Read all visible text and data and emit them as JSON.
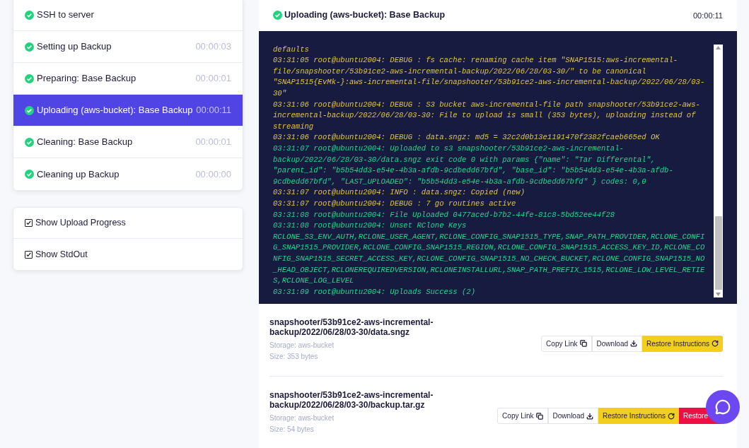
{
  "steps": [
    {
      "label": "SSH to server",
      "done": true,
      "selected": false
    },
    {
      "label": "Setting up Backup",
      "time": "00:00:03",
      "done": true,
      "selected": false
    },
    {
      "label": "Preparing: Base Backup",
      "time": "00:00:01",
      "done": true,
      "selected": false
    },
    {
      "label": "Uploading (aws-bucket): Base Backup",
      "time": "00:00:11",
      "done": true,
      "selected": true
    },
    {
      "label": "Cleaning: Base Backup",
      "time": "00:00:01",
      "done": true,
      "selected": false
    },
    {
      "label": "Cleaning up Backup",
      "time": "00:00:00",
      "done": true,
      "selected": false
    }
  ],
  "options": [
    {
      "label": "Show Upload Progress",
      "checked": true
    },
    {
      "label": "Show StdOut",
      "checked": true
    }
  ],
  "header": {
    "title": "Uploading (aws-bucket): Base Backup",
    "done": true,
    "time": "00:00:11"
  },
  "log": [
    {
      "text": "defaults",
      "color": "#e2c340"
    },
    {
      "text": "03:31:05 root@ubuntu2004: DEBUG : fs cache: renaming cache item \"SNAP1515:aws-incremental-file/snapshooter/53b91ce2-aws-incremental-backup/2022/06/28/03-30/\" to be canonical \"SNAP1515{EvMk-}:aws-incremental-file/snapshooter/53b91ce2-aws-incremental-backup/2022/06/28/03-30\"",
      "color": "#e2c340"
    },
    {
      "text": "03:31:06 root@ubuntu2004: DEBUG : S3 bucket aws-incremental-file path snapshooter/53b91ce2-aws-incremental-backup/2022/06/28/03-30: File to upload is small (353 bytes), uploading instead of streaming",
      "color": "#e2c340"
    },
    {
      "text": "03:31:06 root@ubuntu2004: DEBUG : data.sngz: md5 = 32c2d0b13e1191470f2382fcaeb665ed OK",
      "color": "#e2c340"
    },
    {
      "text": "03:31:07 root@ubuntu2004: Uploaded to s3 snapshooter/53b91ce2-aws-incremental-backup/2022/06/28/03-30/data.sngz exit code 0 with params {\"name\": \"Tar Differental\", \"parent_id\": \"b5b54dd3-e54e-4b3a-afdb-9cdbedd67bfd\", \"base_id\": \"b5b54dd3-e54e-4b3a-afdb-9cdbedd67bfd\", \"LAST_UPLOADED\": \"b5b54dd3-e54e-4b3a-afdb-9cdbedd67bfd\" } codes: 0,0",
      "color": "#1fd88a"
    },
    {
      "text": "03:31:07 root@ubuntu2004: INFO : data.sngz: Copied (new)",
      "color": "#e2c340"
    },
    {
      "text": "03:31:07 root@ubuntu2004: DEBUG : 7 go routines active",
      "color": "#e2c340"
    },
    {
      "text": "03:31:08 root@ubuntu2004: File Uploaded 0477aced-b7b2-44fe-81c8-5bd52ee44f28",
      "color": "#1fd88a"
    },
    {
      "text": "03:31:08 root@ubuntu2004: Unset RClone Keys RCLONE_S3_ENV_AUTH,RCLONE_USER_AGENT,RCLONE_CONFIG_SNAP1515_TYPE,SNAP_PATH_PROVIDER,RCLONE_CONFIG_SNAP1515_PROVIDER,RCLONE_CONFIG_SNAP1515_REGION,RCLONE_CONFIG_SNAP1515_ACCESS_KEY_ID,RCLONE_CONFIG_SNAP1515_SECRET_ACCESS_KEY,RCLONE_CONFIG_SNAP1515_NO_CHECK_BUCKET,RCLONE_CONFIG_SNAP1515_NO_HEAD_OBJECT,RCLONEREQUIREDVERSION,RCLONEINSTALLURL,SNAP_PATH_PREFIX_1515,RCLONE_LOW_LEVEL_RETIES,RCLONE_LOG_LEVEL",
      "color": "#1fd88a"
    },
    {
      "text": "03:31:09 root@ubuntu2004: Uploads Success (2)",
      "color": "#1fd88a"
    }
  ],
  "files": [
    {
      "path": "snapshooter/53b91ce2-aws-incremental-backup/2022/06/28/03-30/data.sngz",
      "storage": "Storage: aws-bucket",
      "size": "Size: 353 bytes",
      "buttons": [
        {
          "label": "Copy Link",
          "kind": "copy"
        },
        {
          "label": "Download",
          "kind": "download"
        },
        {
          "label": "Restore Instructions",
          "kind": "instructions"
        }
      ]
    },
    {
      "path": "snapshooter/53b91ce2-aws-incremental-backup/2022/06/28/03-30/backup.tar.gz",
      "storage": "Storage: aws-bucket",
      "size": "Size: 54 bytes",
      "buttons": [
        {
          "label": "Copy Link",
          "kind": "copy"
        },
        {
          "label": "Download",
          "kind": "download"
        },
        {
          "label": "Restore Instructions",
          "kind": "instructions"
        },
        {
          "label": "Restore",
          "kind": "restore"
        }
      ]
    }
  ]
}
